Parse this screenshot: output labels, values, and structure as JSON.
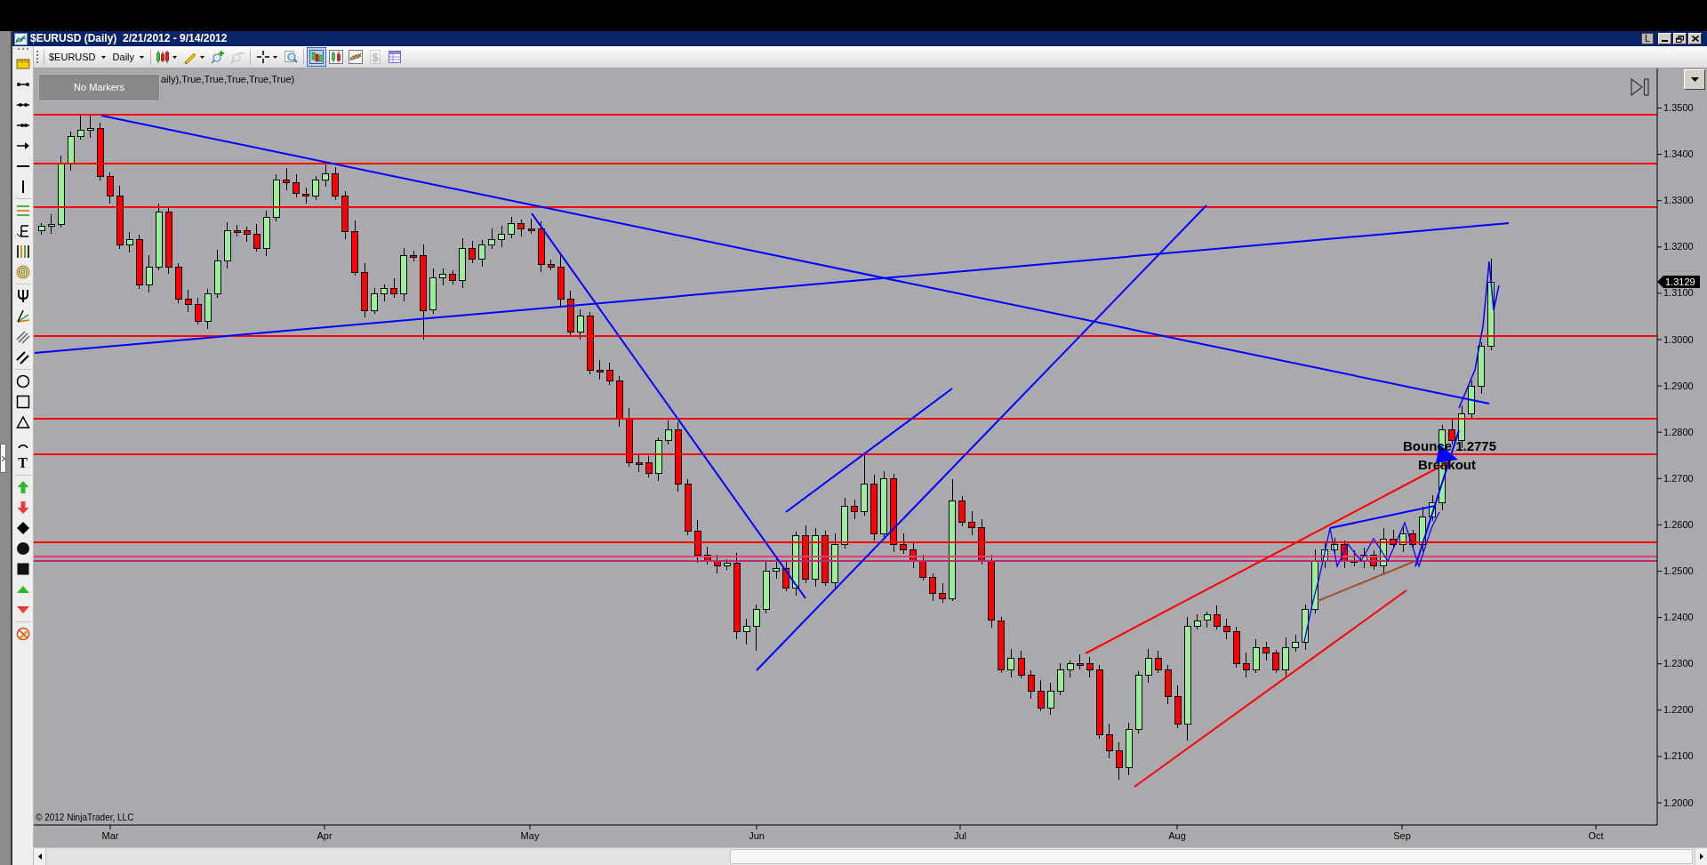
{
  "window": {
    "title": "$EURUSD (Daily)  2/21/2012 - 9/14/2012",
    "layout_button": "L"
  },
  "toolbar": {
    "instrument": "$EURUSD",
    "interval": "Daily",
    "buttons": [
      {
        "selected": false,
        "disabled": false
      },
      {
        "selected": false,
        "disabled": false
      },
      {
        "selected": false,
        "disabled": false
      },
      {
        "selected": false,
        "disabled": true
      },
      {
        "selected": false,
        "disabled": false
      },
      {
        "selected": false,
        "disabled": false
      },
      {
        "selected": true,
        "disabled": false
      },
      {
        "selected": false,
        "disabled": false
      },
      {
        "selected": false,
        "disabled": false
      },
      {
        "selected": false,
        "disabled": true,
        "glyph": "$"
      },
      {
        "selected": false,
        "disabled": false
      }
    ]
  },
  "drawing_tools": {
    "text_tool": "T"
  },
  "chart": {
    "markers_label": "No Markers",
    "indicator_label": "aily),True,True,True,True,True)",
    "price_labels": [
      "1.3500",
      "1.3400",
      "1.3300",
      "1.3200",
      "1.3100",
      "1.3000",
      "1.2900",
      "1.2800",
      "1.2700",
      "1.2600",
      "1.2500",
      "1.2400",
      "1.2300",
      "1.2200",
      "1.2100",
      "1.2000"
    ],
    "last_price": "1.3129",
    "date_labels": [
      "Mar",
      "Apr",
      "May",
      "Jun",
      "Jul",
      "Aug",
      "Sep",
      "Oct"
    ],
    "annotations": [
      "Bounce 1.2775",
      "Breakout"
    ],
    "copyright": "© 2012 NinjaTrader, LLC"
  }
}
